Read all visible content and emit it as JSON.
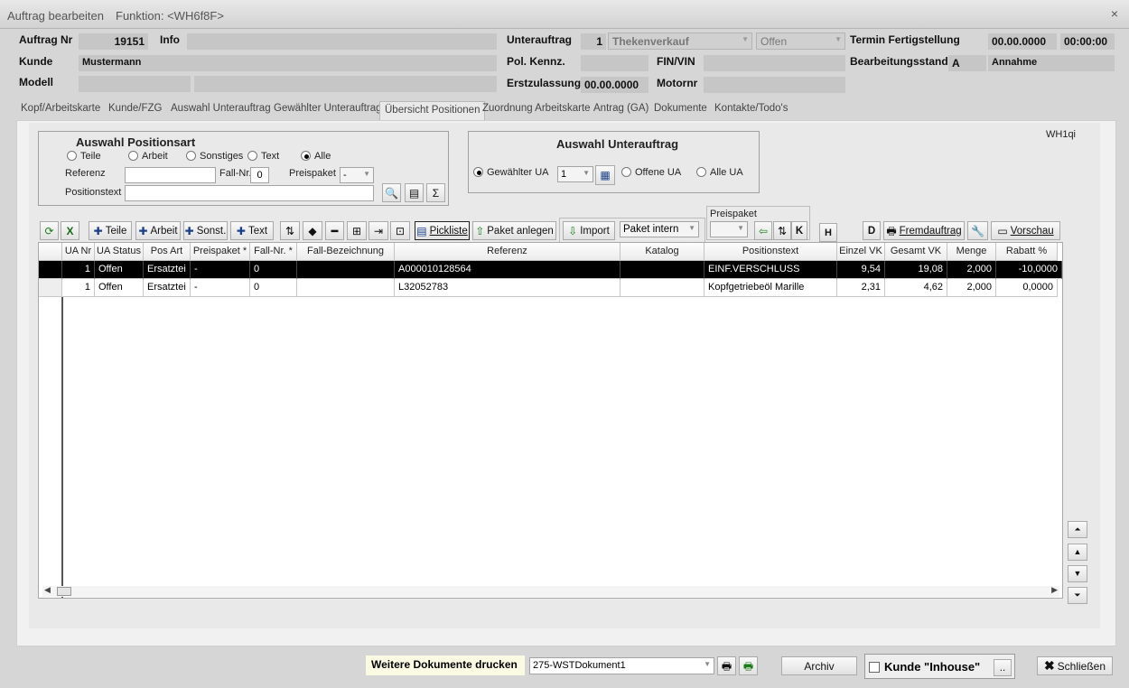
{
  "window": {
    "title": "Auftrag bearbeiten",
    "function": "Funktion: <WH6f8F>",
    "close": "×"
  },
  "header": {
    "auftrag_label": "Auftrag Nr",
    "auftrag_value": "19151",
    "info_label": "Info",
    "kunde_label": "Kunde",
    "kunde_value": "Mustermann",
    "modell_label": "Modell",
    "unterauftrag_label": "Unterauftrag",
    "unterauftrag_nr": "1",
    "unterauftrag_type": "Thekenverkauf",
    "unterauftrag_status": "Offen",
    "polkennz_label": "Pol. Kennz.",
    "fin_label": "FIN/VIN",
    "erstzul_label": "Erstzulassung",
    "erstzul_value": "00.00.0000",
    "motornr_label": "Motornr",
    "termin_label": "Termin Fertigstellung",
    "termin_date": "00.00.0000",
    "termin_time": "00:00:00",
    "bearb_label": "Bearbeitungsstand",
    "bearb_code": "A",
    "bearb_value": "Annahme"
  },
  "tabs": [
    "Kopf/Arbeitskarte",
    "Kunde/FZG",
    "Auswahl Unterauftrag",
    "Gewählter Unterauftrag",
    "Übersicht Positionen",
    "Zuordnung Arbeitskarte",
    "Antrag (GA)",
    "Dokumente",
    "Kontakte/Todo's"
  ],
  "active_tab": "Übersicht Positionen",
  "posart": {
    "title": "Auswahl Positionsart",
    "radios": [
      "Teile",
      "Arbeit",
      "Sonstiges",
      "Text",
      "Alle"
    ],
    "selected": "Alle",
    "referenz_label": "Referenz",
    "fallnr_label": "Fall-Nr.",
    "fallnr_value": "0",
    "preispaket_label": "Preispaket",
    "preispaket_value": "-",
    "positionstext_label": "Positionstext"
  },
  "ua": {
    "title": "Auswahl Unterauftrag",
    "gewaehlt": "Gewählter UA",
    "ua_value": "1",
    "offene": "Offene UA",
    "alle": "Alle UA",
    "selected": "Gewählter UA"
  },
  "wh_code": "WH1qi",
  "toolbar": {
    "teile": "Teile",
    "arbeit": "Arbeit",
    "sonst": "Sonst.",
    "text": "Text",
    "pickliste": "Pickliste",
    "paket_anlegen": "Paket anlegen",
    "import": "Import",
    "paket_intern": "Paket intern",
    "preispaket": "Preispaket",
    "h": "H",
    "d": "D",
    "k": "K",
    "fremdauftrag": "Fremdauftrag",
    "vorschau": "Vorschau"
  },
  "grid": {
    "columns": [
      "UA Nr",
      "UA Status",
      "Pos Art",
      "Preispaket *",
      "Fall-Nr. *",
      "Fall-Bezeichnung",
      "Referenz",
      "Katalog",
      "Positionstext",
      "Einzel VK",
      "Gesamt VK",
      "Menge",
      "Rabatt %"
    ],
    "rows": [
      [
        "1",
        "Offen",
        "Ersatztei",
        "-",
        "0",
        "",
        "A000010128564",
        "",
        "EINF.VERSCHLUSS",
        "9,54",
        "19,08",
        "2,000",
        "-10,0000"
      ],
      [
        "1",
        "Offen",
        "Ersatztei",
        "-",
        "0",
        "",
        "L32052783",
        "",
        "Kopfgetriebeöl Marille",
        "2,31",
        "4,62",
        "2,000",
        "0,0000"
      ]
    ],
    "selected_row": 0
  },
  "footer": {
    "weitere": "Weitere Dokumente drucken",
    "dokument": "275-WSTDokument1",
    "archiv": "Archiv",
    "inhouse": "Kunde \"Inhouse\"",
    "dots": "..",
    "schliessen": "Schließen"
  }
}
